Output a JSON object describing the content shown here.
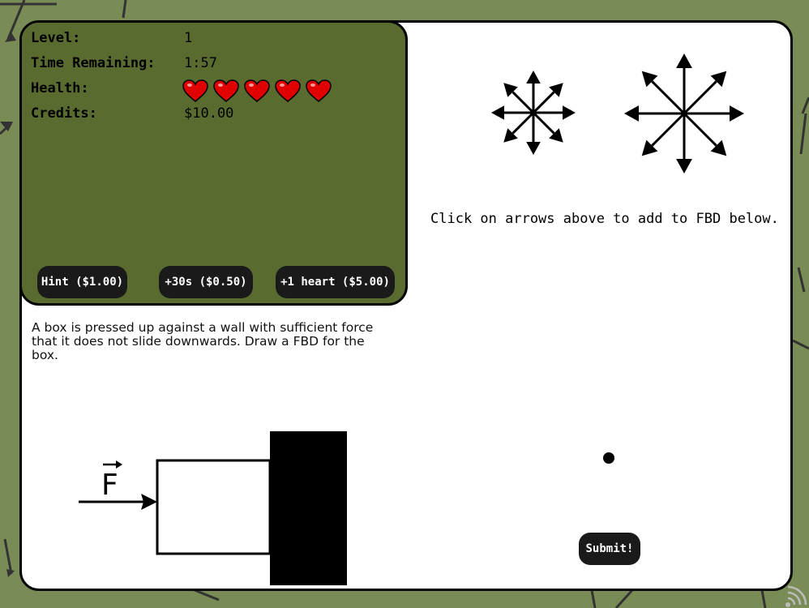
{
  "status": {
    "level_label": "Level:",
    "level_value": "1",
    "time_label": "Time Remaining:",
    "time_value": "1:57",
    "health_label": "Health:",
    "health_value": 5,
    "credits_label": "Credits:",
    "credits_value": "$10.00"
  },
  "shop": {
    "hint_label": "Hint ($1.00)",
    "time_label": "+30s ($0.50)",
    "heart_label": "+1 heart ($5.00)"
  },
  "question": "A box is pressed up against a wall with sufficient force that it does not slide downwards. Draw a FBD for the box.",
  "diagram": {
    "force_label": "F"
  },
  "arrow_panel": {
    "instruction": "Click on arrows above to add to FBD below.",
    "small_rose_icon": "eight-direction-short-arrows-icon",
    "large_rose_icon": "eight-direction-long-arrows-icon"
  },
  "submit_label": "Submit!",
  "colors": {
    "background": "#7a8c55",
    "status_panel": "#5a6b30",
    "button": "#1a1a1a",
    "heart": "#e00000"
  }
}
